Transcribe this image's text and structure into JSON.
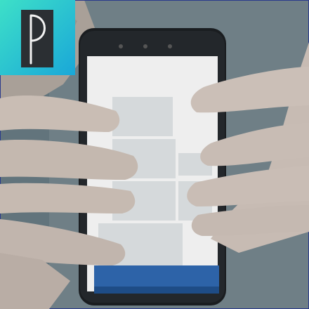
{
  "photo": {
    "description_alt": "",
    "screen_lines": [
      "",
      "",
      ""
    ],
    "bottom_bar_text": ""
  },
  "logo": {
    "letter": "P",
    "colors": {
      "bg_left": "#3de0c8",
      "bg_right": "#1aa7d8",
      "panel": "#2b2f33",
      "stroke": "#f2f2f2"
    }
  },
  "colors": {
    "wall": "#7c8c92",
    "skin": "#c8bcb4",
    "phone": "#1a1d20",
    "screen": "#f0f0f0",
    "tile": "#d6d9db",
    "bar": "#2d63a8"
  }
}
